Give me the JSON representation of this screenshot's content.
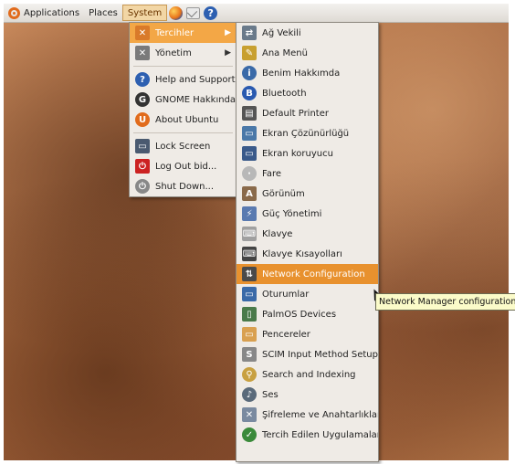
{
  "panel": {
    "applications": "Applications",
    "places": "Places",
    "system": "System"
  },
  "system_menu": {
    "items": [
      {
        "label": "Tercihler",
        "icon": "preferences-icon",
        "color": "#d97a2a"
      },
      {
        "label": "Yönetim",
        "icon": "admin-icon",
        "color": "#7a7a7a"
      },
      {
        "label": "Help and Support",
        "icon": "help-icon",
        "color": "#2d5fb0"
      },
      {
        "label": "GNOME Hakkında",
        "icon": "gnome-icon",
        "color": "#333333"
      },
      {
        "label": "About Ubuntu",
        "icon": "ubuntu-icon",
        "color": "#e16b1c"
      },
      {
        "label": "Lock Screen",
        "icon": "lock-screen-icon",
        "color": "#4a5a70"
      },
      {
        "label": "Log Out bid...",
        "icon": "logout-icon",
        "color": "#cc2222"
      },
      {
        "label": "Shut Down...",
        "icon": "shutdown-icon",
        "color": "#888888"
      }
    ]
  },
  "preferences_menu": {
    "items": [
      {
        "label": "Ağ Vekili",
        "icon": "proxy-icon",
        "color": "#6a7a8a"
      },
      {
        "label": "Ana Menü",
        "icon": "main-menu-icon",
        "color": "#c8a030"
      },
      {
        "label": "Benim Hakkımda",
        "icon": "about-me-icon",
        "color": "#3a6aa8"
      },
      {
        "label": "Bluetooth",
        "icon": "bluetooth-icon",
        "color": "#2a5ab0"
      },
      {
        "label": "Default Printer",
        "icon": "printer-icon",
        "color": "#555555"
      },
      {
        "label": "Ekran Çözünürlüğü",
        "icon": "resolution-icon",
        "color": "#4a78a8"
      },
      {
        "label": "Ekran koruyucu",
        "icon": "screensaver-icon",
        "color": "#3a5a8a"
      },
      {
        "label": "Fare",
        "icon": "mouse-icon",
        "color": "#b8b8b8"
      },
      {
        "label": "Görünüm",
        "icon": "appearance-icon",
        "color": "#8a6a4a"
      },
      {
        "label": "Güç Yönetimi",
        "icon": "power-icon",
        "color": "#5a7ab0"
      },
      {
        "label": "Klavye",
        "icon": "keyboard-icon",
        "color": "#a0a0a0"
      },
      {
        "label": "Klavye Kısayolları",
        "icon": "keyboard-shortcuts-icon",
        "color": "#444444"
      },
      {
        "label": "Network Configuration",
        "icon": "network-icon",
        "color": "#4a4a4a"
      },
      {
        "label": "Oturumlar",
        "icon": "sessions-icon",
        "color": "#3a6aa8"
      },
      {
        "label": "PalmOS Devices",
        "icon": "palm-icon",
        "color": "#4a7a4a"
      },
      {
        "label": "Pencereler",
        "icon": "windows-icon",
        "color": "#d9a050"
      },
      {
        "label": "SCIM Input Method Setup",
        "icon": "scim-icon",
        "color": "#888888"
      },
      {
        "label": "Search and Indexing",
        "icon": "search-icon",
        "color": "#c8a040"
      },
      {
        "label": "Ses",
        "icon": "sound-icon",
        "color": "#5a6a7a"
      },
      {
        "label": "Şifreleme ve Anahtarlıklar",
        "icon": "encryption-icon",
        "color": "#7a8aa0"
      },
      {
        "label": "Tercih Edilen Uygulamalar",
        "icon": "preferred-apps-icon",
        "color": "#3a8a3a"
      }
    ]
  },
  "tooltip": "Network Manager configuration"
}
